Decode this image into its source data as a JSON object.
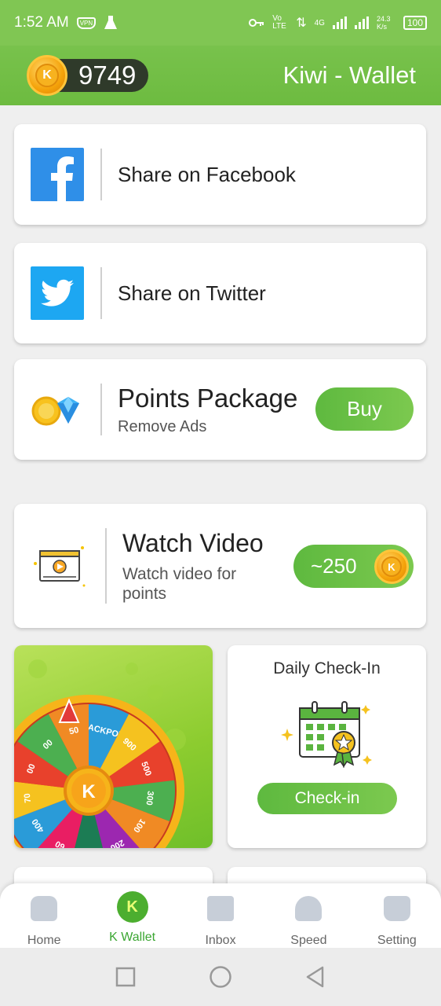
{
  "status_bar": {
    "time": "1:52 AM",
    "vpn": "VPN",
    "volte": "Vo LTE",
    "net": "4G",
    "speed": "24.3 K/s",
    "battery": "100"
  },
  "header": {
    "coin_letter": "K",
    "balance": "9749",
    "title": "Kiwi - Wallet"
  },
  "cards": {
    "facebook": {
      "label": "Share on Facebook"
    },
    "twitter": {
      "label": "Share on Twitter"
    },
    "points_package": {
      "title": "Points Package",
      "subtitle": "Remove Ads",
      "button": "Buy"
    },
    "watch_video": {
      "title": "Watch Video",
      "subtitle": "Watch video for points",
      "button": "~250"
    },
    "spin_wheel": {
      "labels": [
        "JACKPOT",
        "900",
        "500",
        "300",
        "100",
        "200",
        "50",
        "60",
        "400",
        "70",
        "00",
        "00",
        "50"
      ]
    },
    "daily_checkin": {
      "title": "Daily Check-In",
      "button": "Check-in"
    }
  },
  "bottom_nav": {
    "items": [
      {
        "label": "Home",
        "icon": "home-icon"
      },
      {
        "label": "K Wallet",
        "icon": "k-wallet-icon",
        "active": true
      },
      {
        "label": "Inbox",
        "icon": "inbox-icon"
      },
      {
        "label": "Speed",
        "icon": "speed-icon"
      },
      {
        "label": "Setting",
        "icon": "setting-icon"
      }
    ]
  },
  "colors": {
    "brand_green": "#6dbb40",
    "button_green": "#5eb93f",
    "facebook_blue": "#2f8fe8",
    "twitter_blue": "#1da7f2"
  }
}
